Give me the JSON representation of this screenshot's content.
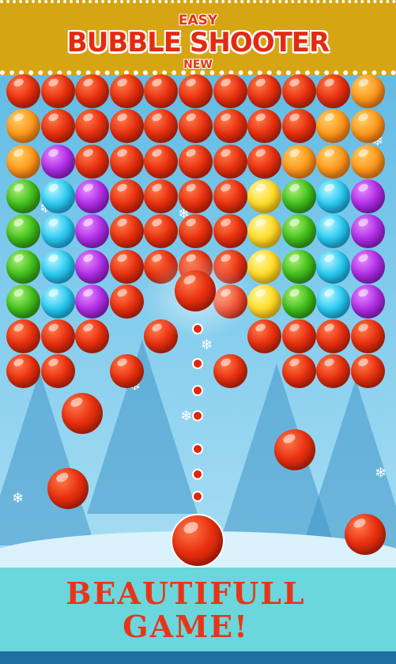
{
  "banner": {
    "top_label": "EASY",
    "title": "BUBBLE SHOOTER",
    "bottom_label": "NEW"
  },
  "footer": {
    "line1": "BEAUTIFULL",
    "line2": "GAME!"
  },
  "colors": {
    "banner_bg": "#d6a514",
    "title_red": "#e22b12",
    "footer_bg": "#6ad7dc"
  },
  "bubble_grid": [
    [
      "red",
      "red",
      "red",
      "red",
      "red",
      "red",
      "red",
      "red",
      "red",
      "red",
      "orange"
    ],
    [
      "orange",
      "red",
      "red",
      "red",
      "red",
      "red",
      "red",
      "red",
      "red",
      "orange",
      "orange"
    ],
    [
      "orange",
      "purple",
      "red",
      "red",
      "red",
      "red",
      "red",
      "red",
      "orange",
      "orange",
      "orange"
    ],
    [
      "green",
      "cyan",
      "purple",
      "red",
      "red",
      "red",
      "red",
      "yellow",
      "green",
      "cyan",
      "purple"
    ],
    [
      "green",
      "cyan",
      "purple",
      "red",
      "red",
      "red",
      "red",
      "yellow",
      "green",
      "cyan",
      "purple"
    ],
    [
      "green",
      "cyan",
      "purple",
      "red",
      "red",
      "red",
      "red",
      "yellow",
      "green",
      "cyan",
      "purple"
    ],
    [
      "green",
      "cyan",
      "purple",
      "red",
      "",
      "",
      "red",
      "yellow",
      "green",
      "cyan",
      "purple"
    ],
    [
      "red",
      "red",
      "red",
      "",
      "red",
      "",
      "",
      "red",
      "red",
      "red",
      "red"
    ],
    [
      "red",
      "red",
      "",
      "red",
      "",
      "",
      "red",
      "",
      "red",
      "red",
      "red"
    ]
  ],
  "shooter": {
    "current_bubble": "red"
  }
}
